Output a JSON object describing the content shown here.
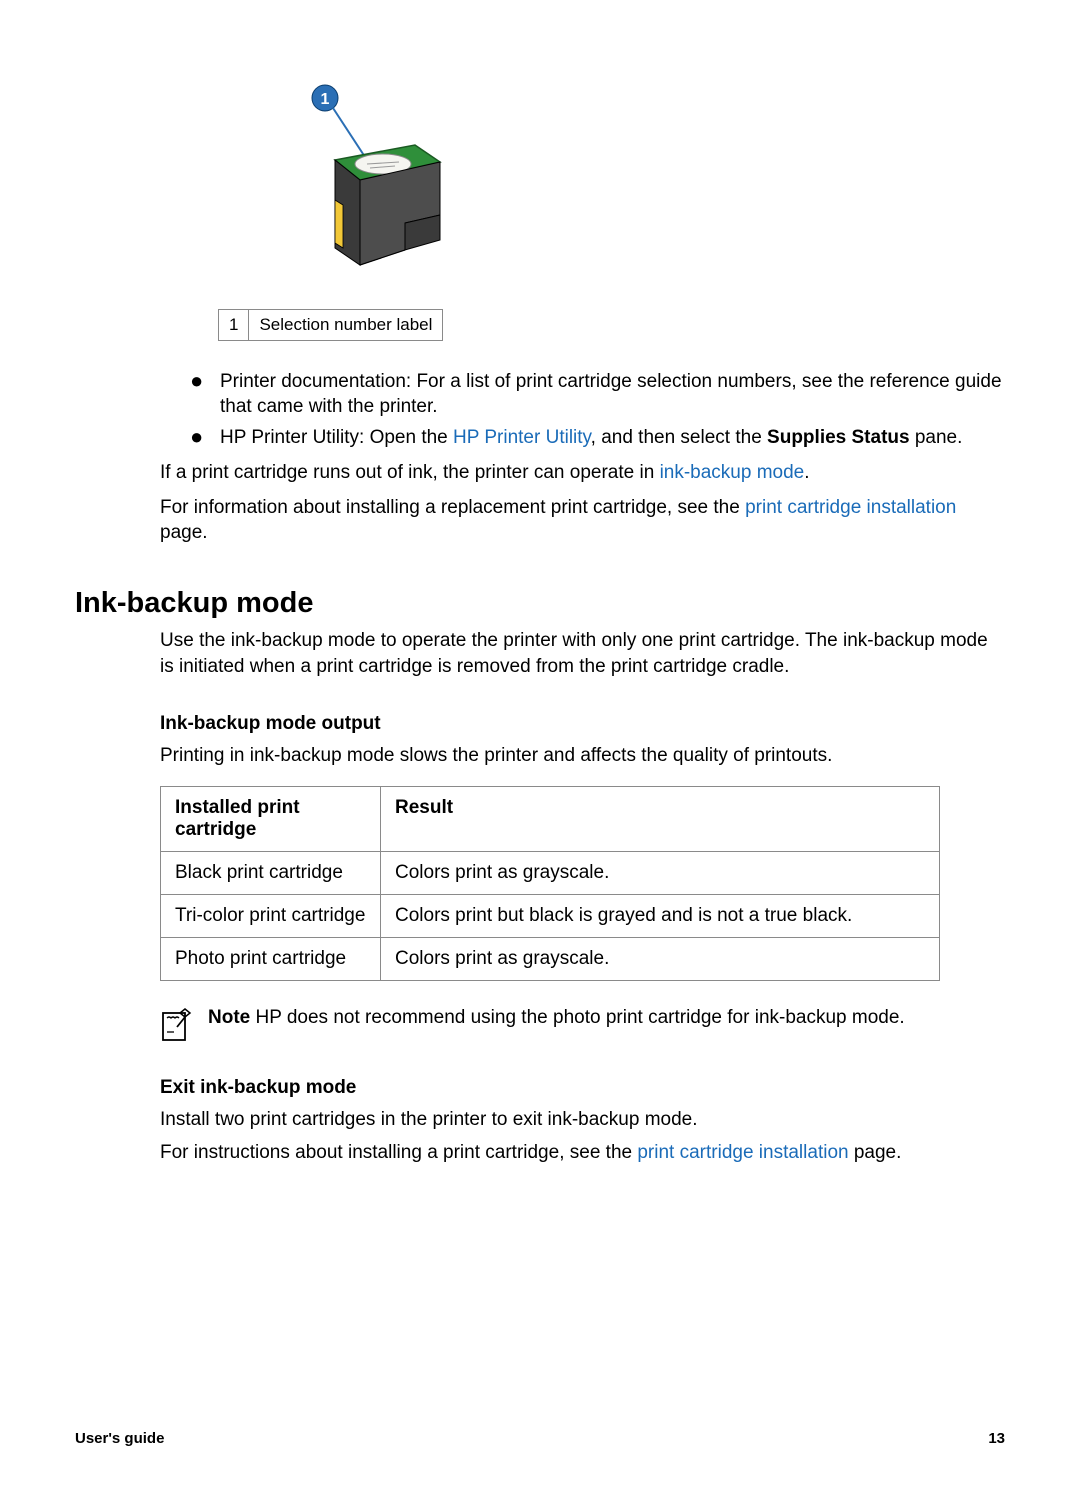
{
  "legend": {
    "num": "1",
    "label": "Selection number label"
  },
  "bullets": [
    {
      "pre": "Printer documentation: For a list of print cartridge selection numbers, see the reference guide that came with the printer."
    },
    {
      "pre": "HP Printer Utility: Open the ",
      "link": "HP Printer Utility",
      "mid": ", and then select the ",
      "bold": "Supplies Status",
      "post": " pane."
    }
  ],
  "para1": {
    "pre": "If a print cartridge runs out of ink, the printer can operate in ",
    "link": "ink-backup mode",
    "post": "."
  },
  "para2": {
    "pre": "For information about installing a replacement print cartridge, see the ",
    "link": "print cartridge installation",
    "post": " page."
  },
  "section": {
    "title": "Ink-backup mode",
    "intro": "Use the ink-backup mode to operate the printer with only one print cartridge. The ink-backup mode is initiated when a print cartridge is removed from the print cartridge cradle."
  },
  "output": {
    "heading": "Ink-backup mode output",
    "desc": "Printing in ink-backup mode slows the printer and affects the quality of printouts."
  },
  "table": {
    "h1": "Installed print cartridge",
    "h2": "Result",
    "rows": [
      {
        "c1": "Black print cartridge",
        "c2": "Colors print as grayscale."
      },
      {
        "c1": "Tri-color print cartridge",
        "c2": "Colors print but black is grayed and is not a true black."
      },
      {
        "c1": "Photo print cartridge",
        "c2": "Colors print as grayscale."
      }
    ]
  },
  "note": {
    "label": "Note",
    "text": " HP does not recommend using the photo print cartridge for ink-backup mode."
  },
  "exit": {
    "heading": "Exit ink-backup mode",
    "p1": "Install two print cartridges in the printer to exit ink-backup mode.",
    "p2pre": "For instructions about installing a print cartridge, see the ",
    "p2link": "print cartridge installation",
    "p2post": " page."
  },
  "footer": {
    "left": "User's guide",
    "right": "13"
  }
}
